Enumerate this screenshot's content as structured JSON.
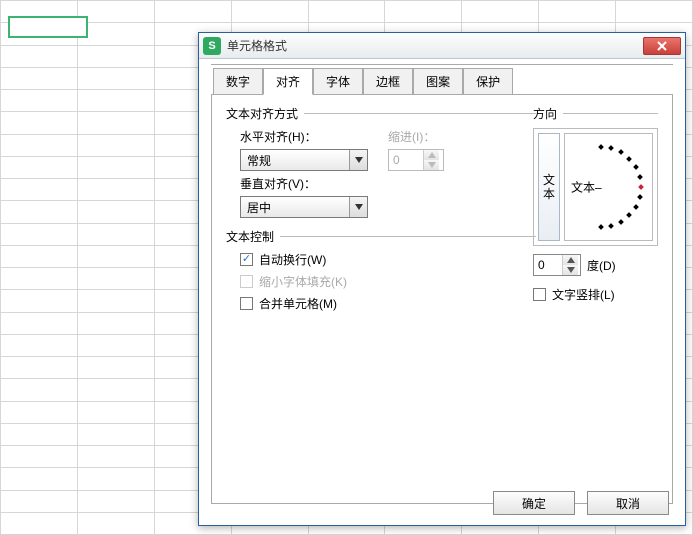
{
  "dialog": {
    "title": "单元格格式",
    "app_icon_letter": "S",
    "tabs": [
      "数字",
      "对齐",
      "字体",
      "边框",
      "图案",
      "保护"
    ],
    "active_tab_index": 1
  },
  "align": {
    "group_title": "文本对齐方式",
    "h_label": "水平对齐(H)：",
    "h_value": "常规",
    "indent_label": "缩进(I)：",
    "indent_value": "0",
    "v_label": "垂直对齐(V)：",
    "v_value": "居中"
  },
  "text_control": {
    "group_title": "文本控制",
    "wrap_label": "自动换行(W)",
    "wrap_checked": true,
    "shrink_label": "缩小字体填充(K)",
    "shrink_checked": false,
    "shrink_disabled": true,
    "merge_label": "合并单元格(M)",
    "merge_checked": false
  },
  "direction": {
    "group_title": "方向",
    "vertical_text_chars": [
      "文",
      "本"
    ],
    "arc_label": "文本",
    "degree_value": "0",
    "degree_label": "度(D)",
    "vertical_checkbox_label": "文字竖排(L)",
    "vertical_checkbox_checked": false
  },
  "footer": {
    "ok": "确定",
    "cancel": "取消"
  }
}
